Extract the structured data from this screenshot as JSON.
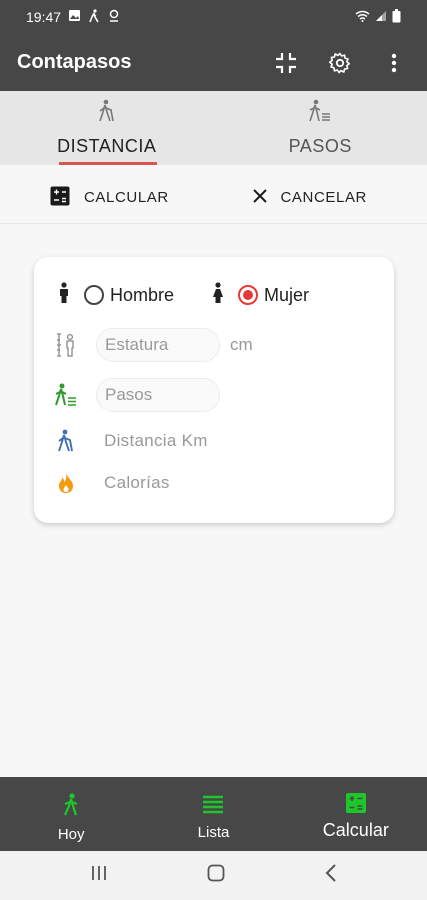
{
  "status_bar": {
    "time": "19:47",
    "left_icons": [
      "image-icon",
      "walking-icon",
      "accessibility-icon"
    ],
    "right_icons": [
      "wifi-icon",
      "signal-icon",
      "battery-icon"
    ]
  },
  "app_bar": {
    "title": "Contapasos",
    "actions": [
      "fullscreen-exit-icon",
      "settings-icon",
      "more-vert-icon"
    ]
  },
  "tabs": [
    {
      "label": "DISTANCIA",
      "icon": "walking-with-cane-icon",
      "active": true
    },
    {
      "label": "PASOS",
      "icon": "walking-steps-icon",
      "active": false
    }
  ],
  "action_row": {
    "calculate_label": "CALCULAR",
    "cancel_label": "CANCELAR"
  },
  "form": {
    "gender_male_label": "Hombre",
    "gender_female_label": "Mujer",
    "selected_gender": "Mujer",
    "height_placeholder": "Estatura",
    "height_unit": "cm",
    "steps_placeholder": "Pasos",
    "distance_label": "Distancia  Km",
    "calories_label": "Calorías"
  },
  "bottom_nav": [
    {
      "label": "Hoy",
      "icon": "walking-icon",
      "active": false
    },
    {
      "label": "Lista",
      "icon": "list-icon",
      "active": false
    },
    {
      "label": "Calcular",
      "icon": "calculator-icon",
      "active": true
    }
  ],
  "colors": {
    "bar_bg": "#474747",
    "accent_green": "#1ec729",
    "tab_indicator": "#d9534f",
    "radio_selected": "#e53935",
    "calories_orange": "#f39c12",
    "distance_blue": "#3f6fb5",
    "steps_green": "#2e9a2e"
  }
}
